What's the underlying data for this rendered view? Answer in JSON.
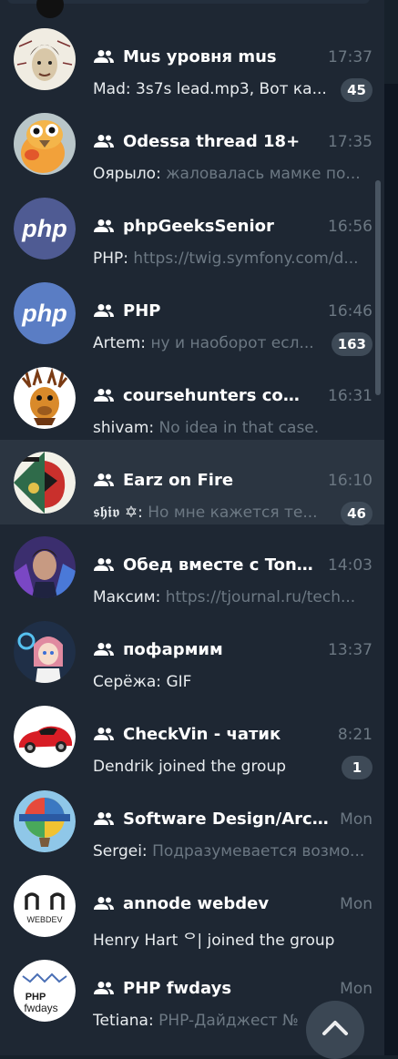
{
  "colors": {
    "panel_bg": "#1e2733",
    "selected_row_bg": "#2b3541",
    "title_text": "#ffffff",
    "muted_text": "#6c7883",
    "sender_text": "#e8ecef",
    "badge_bg": "#3e4a57",
    "php_avatar": "#5167a5"
  },
  "chats": [
    {
      "title": "Mus уровня mus",
      "time": "17:37",
      "sender": "Mad:",
      "message": "3s7s lead.mp3, Вот ка...",
      "message_style": "mixed",
      "badge": "45",
      "avatar": "bob-dylan-drawing"
    },
    {
      "title": "Odessa thread 18+",
      "time": "17:35",
      "sender": "Оярыло:",
      "message": "жаловалась мамке по...",
      "badge": "",
      "avatar": "bird-photo"
    },
    {
      "title": "phpGeeksSenior",
      "time": "16:56",
      "sender": "PHP:",
      "message": "https://twig.symfony.com/d...",
      "badge": "",
      "avatar": "php-logo"
    },
    {
      "title": "PHP",
      "time": "16:46",
      "sender": "Artem:",
      "message": "ну и наоборот есл...",
      "badge": "163",
      "avatar": "php-logo"
    },
    {
      "title": "coursehunters comm...",
      "time": "16:31",
      "sender": "shivam:",
      "message": "No idea in that case.",
      "badge": "",
      "avatar": "cartoon-moose"
    },
    {
      "title": "Earz on Fire",
      "time": "16:10",
      "sender": "𝖘𝖍𝖎𝖛 ✡:",
      "message": "Но мне кажется те...",
      "badge": "46",
      "avatar": "earz-poster",
      "selected": true
    },
    {
      "title": "Обед вместе с Tonti ...",
      "time": "14:03",
      "sender": "Максим:",
      "message": "https://tjournal.ru/tech...",
      "badge": "",
      "avatar": "man-portrait"
    },
    {
      "title": "пофармим",
      "time": "13:37",
      "sender": "Серёжа:",
      "message": "GIF",
      "message_style": "plain",
      "badge": "",
      "avatar": "anime-girl"
    },
    {
      "title": "CheckVin - чатик",
      "time": "8:21",
      "sender": "",
      "message": "Dendrik joined the group",
      "message_style": "plain",
      "badge": "1",
      "avatar": "red-car"
    },
    {
      "title": "Software Design/Archit...",
      "time": "Mon",
      "sender": "Sergei:",
      "message": "Подразумевается возмо...",
      "badge": "",
      "avatar": "balloon"
    },
    {
      "title": "annode webdev",
      "time": "Mon",
      "sender": "",
      "message": "Henry Hart ᄋ| joined the group",
      "message_style": "plain",
      "badge": "",
      "avatar": "webdev-logo",
      "avatar_text": "WEBDEV"
    },
    {
      "title": "PHP fwdays",
      "time": "Mon",
      "sender": "Tetiana:",
      "message": "PHP-Дайджест №",
      "badge": "",
      "avatar": "fwdays-logo",
      "avatar_text_1": "PHP",
      "avatar_text_2": "fwdays"
    }
  ],
  "php_logo_text": "php",
  "scroll_top_button": {
    "icon": "chevron-up-icon"
  }
}
